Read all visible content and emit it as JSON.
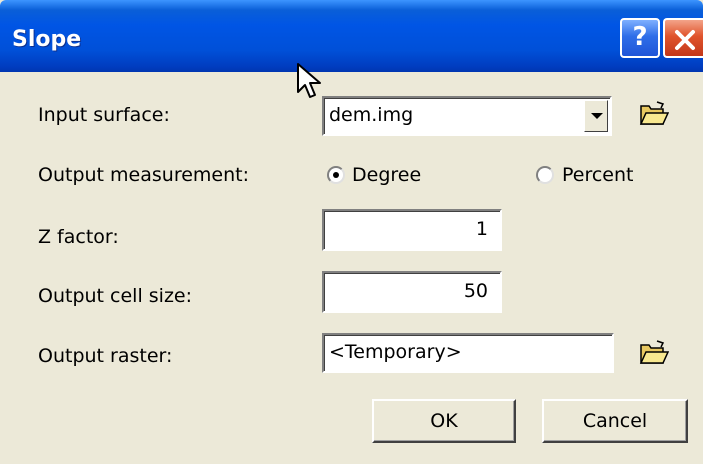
{
  "window": {
    "title": "Slope",
    "help_label": "?"
  },
  "form": {
    "input_surface": {
      "label": "Input surface:",
      "value": "dem.img"
    },
    "output_measurement": {
      "label": "Output measurement:",
      "options": [
        "Degree",
        "Percent"
      ],
      "selected": "Degree"
    },
    "z_factor": {
      "label": "Z factor:",
      "value": "1"
    },
    "output_cell_size": {
      "label": "Output cell size:",
      "value": "50"
    },
    "output_raster": {
      "label": "Output raster:",
      "value": "<Temporary>"
    }
  },
  "buttons": {
    "ok": "OK",
    "cancel": "Cancel"
  },
  "icons": {
    "help": "help-icon",
    "close": "close-icon",
    "folder": "open-folder-icon",
    "dropdown": "chevron-down-icon",
    "cursor": "mouse-pointer-icon"
  }
}
